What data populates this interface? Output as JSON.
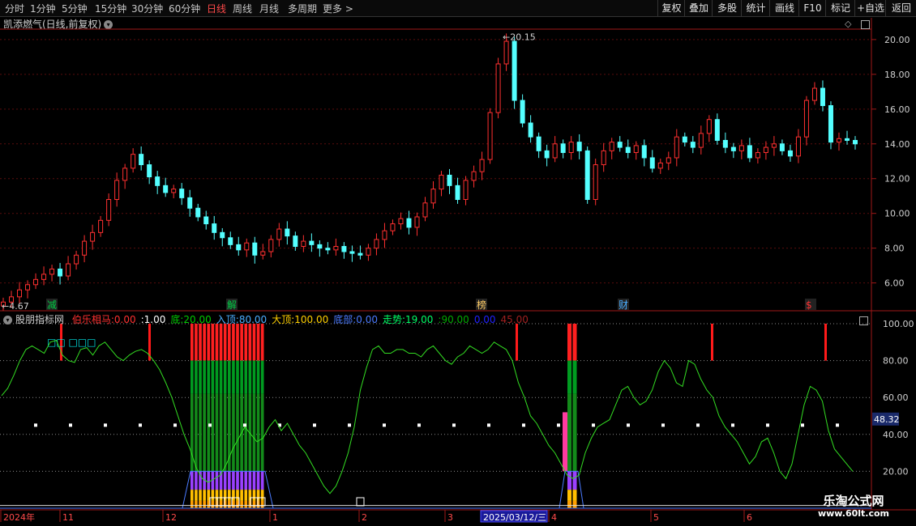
{
  "toolbar": {
    "periods": [
      "分时",
      "1分钟",
      "5分钟",
      "15分钟",
      "30分钟",
      "60分钟",
      "日线",
      "周线",
      "月线",
      "多周期",
      "更多 >"
    ],
    "active_period": "日线",
    "right_buttons": [
      "复权",
      "叠加",
      "多股",
      "统计",
      "画线",
      "F10",
      "标记",
      "+自选",
      "返回"
    ]
  },
  "chart_title": "凯添燃气(日线,前复权)",
  "price_axis": [
    "20.00",
    "18.00",
    "16.00",
    "14.00",
    "12.00",
    "10.00",
    "8.00",
    "6.00"
  ],
  "price_annotations": {
    "high": "20.15",
    "low": "4.67"
  },
  "event_markers": [
    {
      "text": "减",
      "color": "#00cc44"
    },
    {
      "text": "解",
      "color": "#00cc44"
    },
    {
      "text": "榜",
      "color": "#ffcc66"
    },
    {
      "text": "财",
      "color": "#4aaeff"
    },
    {
      "text": "$",
      "color": "#ff3030"
    }
  ],
  "indicator": {
    "name": "股朋指标网",
    "params": [
      {
        "label": "伯乐相马:",
        "value": "0.00",
        "color": "#ff3030"
      },
      {
        "label": ":",
        "value": "1.00",
        "color": "#ffffff"
      },
      {
        "label": "底:",
        "value": "20.00",
        "color": "#00cc00"
      },
      {
        "label": "入顶:",
        "value": "80.00",
        "color": "#4aaeff"
      },
      {
        "label": "大顶:",
        "value": "100.00",
        "color": "#ffd000"
      },
      {
        "label": "底部:",
        "value": "0.00",
        "color": "#4a7aff"
      },
      {
        "label": "走势:",
        "value": "19.00",
        "color": "#00ff66"
      },
      {
        "label": ":",
        "value": "90.00",
        "color": "#00aa00"
      },
      {
        "label": "",
        "value": "0.00",
        "color": "#2020ff"
      },
      {
        "label": "",
        "value": "45.00",
        "color": "#a02020"
      }
    ],
    "axis": [
      "100.00",
      "80.00",
      "60.00",
      "40.00",
      "20.00"
    ],
    "current_value": "48.32",
    "box_label": "□□ □□□"
  },
  "time_axis": {
    "labels": [
      "2024年",
      "11",
      "12",
      "1",
      "2",
      "3",
      "4",
      "5",
      "6"
    ],
    "cursor_date": "2025/03/12/三"
  },
  "watermark": {
    "site": "乐淘公式网",
    "url": "www.60lt.com"
  },
  "colors": {
    "up": "#ff3030",
    "down": "#54ffff",
    "line": "#33dd22",
    "grid": "#7a1010"
  },
  "chart_data": {
    "type": "candlestick",
    "y_label_range": [
      4.67,
      20.15
    ],
    "ylim": [
      4.4,
      20.6
    ],
    "indicator_ylim": [
      0,
      100
    ],
    "indicator_series": [
      {
        "values": [
          61,
          65,
          72,
          80,
          86,
          88,
          86,
          84,
          90,
          91,
          83,
          80,
          79,
          86,
          87,
          83,
          88,
          90,
          86,
          82,
          80,
          83,
          85,
          86,
          84,
          80,
          75,
          68,
          60,
          50,
          40,
          32,
          22,
          16,
          14,
          16,
          18,
          24,
          32,
          38,
          44,
          40,
          36,
          38,
          44,
          48,
          42,
          46,
          40,
          34,
          30,
          24,
          18,
          12,
          8,
          12,
          20,
          30,
          44,
          64,
          76,
          86,
          88,
          84,
          84,
          86,
          86,
          84,
          84,
          82,
          86,
          88,
          84,
          80,
          78,
          82,
          84,
          88,
          86,
          84,
          86,
          90,
          88,
          86,
          80,
          68,
          60,
          50,
          46,
          40,
          34,
          30,
          24,
          18,
          16,
          18,
          30,
          38,
          44,
          46,
          48,
          56,
          64,
          66,
          60,
          56,
          58,
          64,
          74,
          80,
          76,
          68,
          66,
          80,
          78,
          70,
          64,
          60,
          50,
          44,
          40,
          36,
          30,
          24,
          28,
          36,
          38,
          30,
          20,
          16,
          24,
          40,
          56,
          66,
          64,
          58,
          42,
          32,
          28,
          24,
          20
        ]
      }
    ]
  }
}
